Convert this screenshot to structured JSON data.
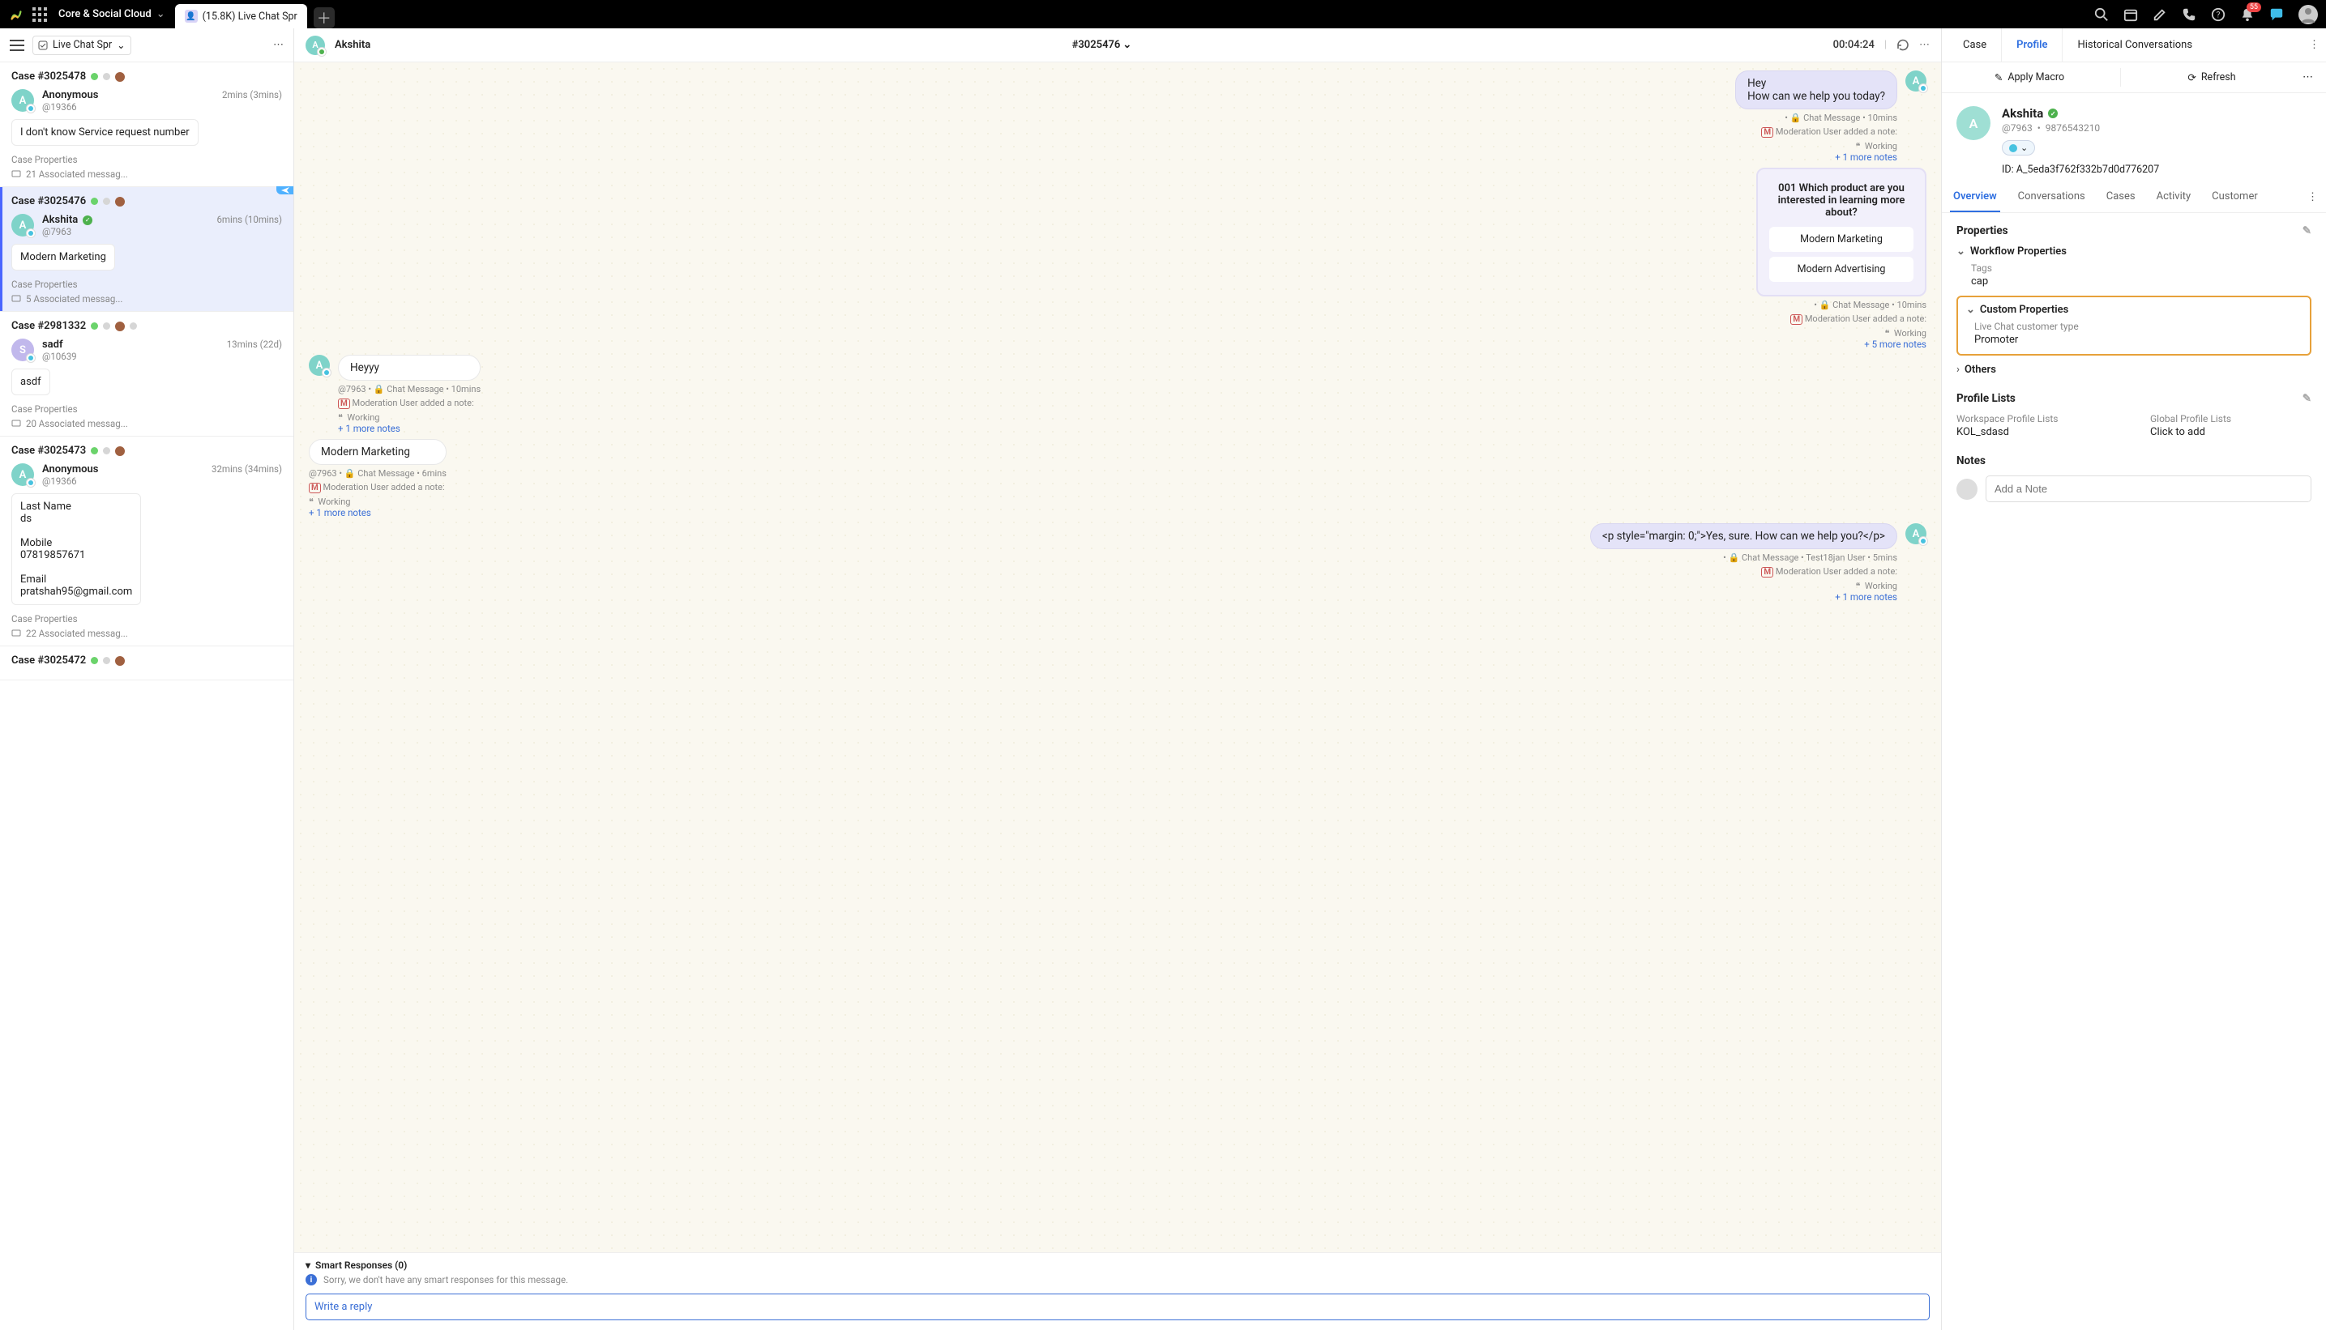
{
  "topbar": {
    "brand": "Core & Social Cloud",
    "tab_label": "(15.8K) Live Chat Spr",
    "notif_count": "55"
  },
  "left": {
    "column_name": "Live Chat Spr",
    "cases": [
      {
        "title": "Case #3025478",
        "user": "Anonymous",
        "handle": "@19366",
        "time": "2mins",
        "paren": "(3mins)",
        "preview": "I don&#39;t know Service request number",
        "meta": "Case Properties",
        "assoc": "21 Associated messag...",
        "av_bg": "teal",
        "av_letter": "A",
        "verified": false
      },
      {
        "title": "Case #3025476",
        "user": "Akshita",
        "handle": "@7963",
        "time": "6mins",
        "paren": "(10mins)",
        "preview": "Modern Marketing",
        "meta": "Case Properties",
        "assoc": "5 Associated messag...",
        "av_bg": "teal",
        "av_letter": "A",
        "verified": true,
        "active": true,
        "send": true
      },
      {
        "title": "Case #2981332",
        "user": "sadf",
        "handle": "@10639",
        "time": "13mins",
        "paren": "(22d)",
        "preview": "asdf",
        "meta": "Case Properties",
        "assoc": "20 Associated messag...",
        "av_bg": "purple",
        "av_letter": "S",
        "verified": false,
        "extra_dot": true
      },
      {
        "title": "Case #3025473",
        "user": "Anonymous",
        "handle": "@19366",
        "time": "32mins",
        "paren": "(34mins)",
        "preview": "Last Name\nds\n\nMobile\n07819857671\n\nEmail\npratshah95@gmail.com",
        "meta": "Case Properties",
        "assoc": "22 Associated messag...",
        "av_bg": "teal",
        "av_letter": "A",
        "verified": false
      },
      {
        "title": "Case #3025472",
        "user": "",
        "handle": "",
        "time": "",
        "paren": "",
        "preview": "",
        "meta": "",
        "assoc": "",
        "av_bg": "",
        "av_letter": "",
        "partial": true
      }
    ]
  },
  "mid": {
    "user": "Akshita",
    "caseno": "#3025476",
    "timer": "00:04:24",
    "messages": [
      {
        "side": "right",
        "text": "Hey\nHow can we help you today?",
        "meta": "Chat Message  •  10mins",
        "mod": "Moderation User added a note:",
        "note": "Working",
        "more": "+ 1 more notes",
        "avatar": true
      },
      {
        "side": "right",
        "question": true,
        "q": "001 Which product are you interested in learning more about?",
        "opts": [
          "Modern Marketing",
          "Modern Advertising"
        ],
        "meta": "Chat Message  •  10mins",
        "mod": "Moderation User added a note:",
        "note": "Working",
        "more": "+ 5 more notes"
      },
      {
        "side": "left",
        "text": "Heyyy",
        "submeta": "@7963  •  🔒 Chat Message  •  10mins",
        "mod": "Moderation User added a note:",
        "note": "Working",
        "more": "+ 1 more notes",
        "avatar": true
      },
      {
        "side": "left",
        "text": "Modern Marketing",
        "submeta": "@7963  •  🔒 Chat Message  •  6mins",
        "mod": "Moderation User added a note:",
        "note": "Working",
        "more": "+ 1 more notes"
      },
      {
        "side": "right",
        "text": "&lt;p style=&quot;margin: 0;&quot;&gt;Yes, sure. How can we help you?&lt;/p&gt;",
        "meta": "Chat Message  •  Test18jan User  •  5mins",
        "mod": "Moderation User added a note:",
        "note": "Working",
        "more": "+ 1 more notes",
        "avatar": true
      }
    ],
    "smart_label": "Smart Responses (0)",
    "smart_info": "Sorry, we don't have any smart responses for this message.",
    "reply_placeholder": "Write a reply"
  },
  "right": {
    "tabs": [
      "Case",
      "Profile",
      "Historical Conversations"
    ],
    "apply_macro": "Apply Macro",
    "refresh": "Refresh",
    "profile": {
      "name": "Akshita",
      "handle": "@7963",
      "phone": "9876543210",
      "id_label": "ID:",
      "id": "A_5eda3f762f332b7d0d776207"
    },
    "subtabs": [
      "Overview",
      "Conversations",
      "Cases",
      "Activity",
      "Customer"
    ],
    "properties": {
      "heading": "Properties",
      "workflow": {
        "title": "Workflow Properties",
        "tags_k": "Tags",
        "tags_v": "cap"
      },
      "custom": {
        "title": "Custom Properties",
        "k": "Live Chat customer type",
        "v": "Promoter"
      },
      "others": "Others"
    },
    "profile_lists": {
      "heading": "Profile Lists",
      "ws_k": "Workspace Profile Lists",
      "ws_v": "KOL_sdasd",
      "gl_k": "Global Profile Lists",
      "gl_v": "Click to add"
    },
    "notes": {
      "heading": "Notes",
      "placeholder": "Add a Note"
    }
  }
}
